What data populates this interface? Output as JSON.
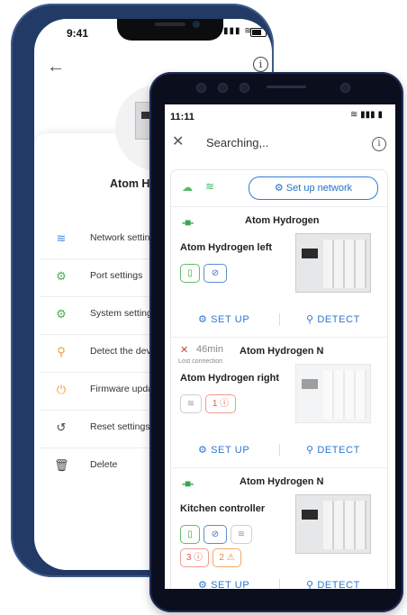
{
  "back_screen": {
    "time": "9:41",
    "device_name": "Atom Hy",
    "menu": [
      {
        "label": "Network setting",
        "icon": "wifi-icon",
        "color": "#3b8fe0"
      },
      {
        "label": "Port settings",
        "icon": "port-gear-icon",
        "color": "#4caf50"
      },
      {
        "label": "System settings",
        "icon": "gears-icon",
        "color": "#4caf50"
      },
      {
        "label": "Detect the device",
        "icon": "search-icon",
        "color": "#f29a2e"
      },
      {
        "label": "Firmware update",
        "icon": "power-icon",
        "color": "#f29a2e"
      },
      {
        "label": "Reset settings",
        "icon": "reset-icon",
        "color": "#444444"
      },
      {
        "label": "Delete",
        "icon": "trash-icon",
        "color": "#444444"
      }
    ]
  },
  "front_screen": {
    "time": "11:11",
    "title": "Searching,..",
    "setup_network_label": "Set up network",
    "cards": [
      {
        "title": "Atom Hydrogen",
        "device": "Atom Hydrogen left",
        "setup_label": "SET UP",
        "detect_label": "DETECT"
      },
      {
        "title": "Atom Hydrogen N",
        "offline_time": "46min",
        "lost_text": "Lost connection",
        "device": "Atom Hydrogen right",
        "error_count": "1",
        "setup_label": "SET UP",
        "detect_label": "DETECT"
      },
      {
        "title": "Atom Hydrogen N",
        "device": "Kitchen controller",
        "error_count": "3",
        "warning_count": "2",
        "setup_label": "SET UP",
        "detect_label": "DETECT"
      }
    ]
  },
  "colors": {
    "accent": "#2f7fd6",
    "online": "#43a047",
    "error": "#e25a48",
    "warning": "#e88a2a"
  }
}
